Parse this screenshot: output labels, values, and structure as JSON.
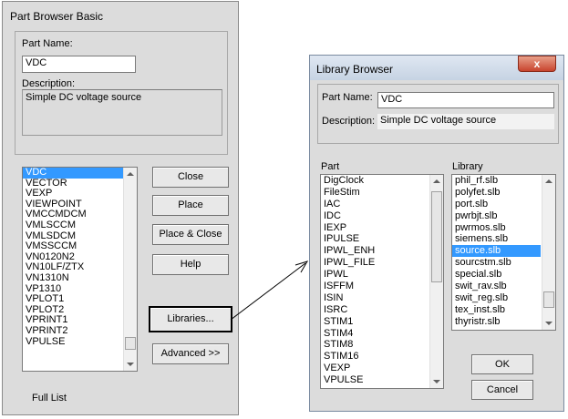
{
  "part_browser": {
    "title": "Part Browser Basic",
    "part_name_label": "Part Name:",
    "part_name_value": "VDC",
    "description_label": "Description:",
    "description_value": "Simple DC voltage source",
    "parts": [
      "VDC",
      "VECTOR",
      "VEXP",
      "VIEWPOINT",
      "VMCCMDCM",
      "VMLSCCM",
      "VMLSDCM",
      "VMSSCCM",
      "VN0120N2",
      "VN10LF/ZTX",
      "VN1310N",
      "VP1310",
      "VPLOT1",
      "VPLOT2",
      "VPRINT1",
      "VPRINT2",
      "VPULSE"
    ],
    "selected_part": "VDC",
    "buttons": {
      "close": "Close",
      "place": "Place",
      "place_close": "Place & Close",
      "help": "Help",
      "libraries": "Libraries...",
      "advanced": "Advanced >>"
    },
    "full_list_label": "Full List"
  },
  "library_browser": {
    "title": "Library Browser",
    "close_glyph": "x",
    "part_name_label": "Part Name:",
    "part_name_value": "VDC",
    "description_label": "Description:",
    "description_value": "Simple DC voltage source",
    "part_list_label": "Part",
    "library_list_label": "Library",
    "parts": [
      "DigClock",
      "FileStim",
      "IAC",
      "IDC",
      "IEXP",
      "IPULSE",
      "IPWL_ENH",
      "IPWL_FILE",
      "IPWL",
      "ISFFM",
      "ISIN",
      "ISRC",
      "STIM1",
      "STIM4",
      "STIM8",
      "STIM16",
      "VEXP",
      "VPULSE"
    ],
    "libraries": [
      "phil_rf.slb",
      "polyfet.slb",
      "port.slb",
      "pwrbjt.slb",
      "pwrmos.slb",
      "siemens.slb",
      "source.slb",
      "sourcstm.slb",
      "special.slb",
      "swit_rav.slb",
      "swit_reg.slb",
      "tex_inst.slb",
      "thyristr.slb"
    ],
    "selected_library": "source.slb",
    "buttons": {
      "ok": "OK",
      "cancel": "Cancel"
    }
  }
}
